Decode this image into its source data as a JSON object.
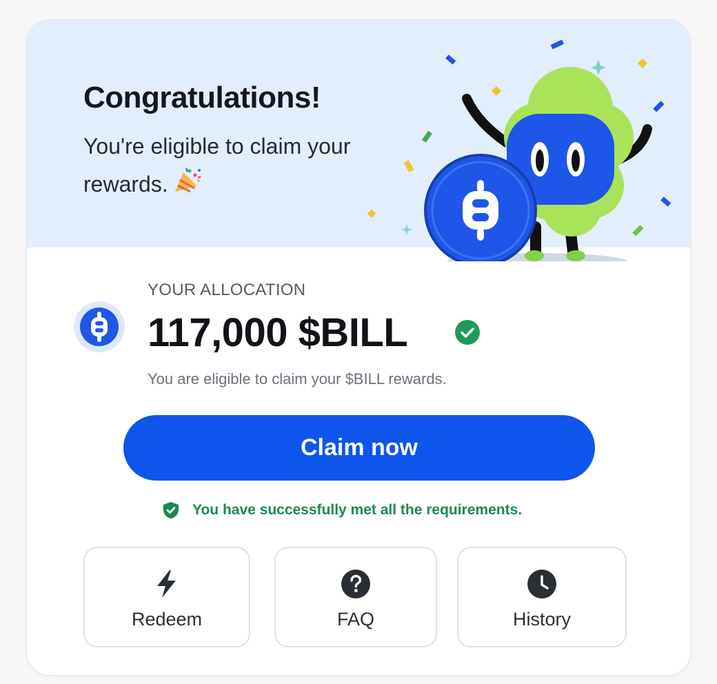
{
  "hero": {
    "title": "Congratulations!",
    "subtitle": "You're eligible to claim your rewards.",
    "background_color": "#e2eefb",
    "icon": "party-popper-icon",
    "illustration": "mascot-with-coin"
  },
  "allocation": {
    "label": "YOUR ALLOCATION",
    "amount": "117,000 $BILL",
    "token_icon": "bill-coin-icon",
    "verified_icon": "verified-check-icon",
    "description": "You are eligible to claim your $BILL rewards."
  },
  "claim": {
    "button_label": "Claim now",
    "button_color": "#0d55eb"
  },
  "requirements": {
    "icon": "shield-check-icon",
    "message": "You have successfully met all the requirements.",
    "color": "#178a52"
  },
  "actions": [
    {
      "label": "Redeem",
      "icon": "lightning-bolt-icon"
    },
    {
      "label": "FAQ",
      "icon": "question-circle-icon"
    },
    {
      "label": "History",
      "icon": "clock-icon"
    }
  ]
}
